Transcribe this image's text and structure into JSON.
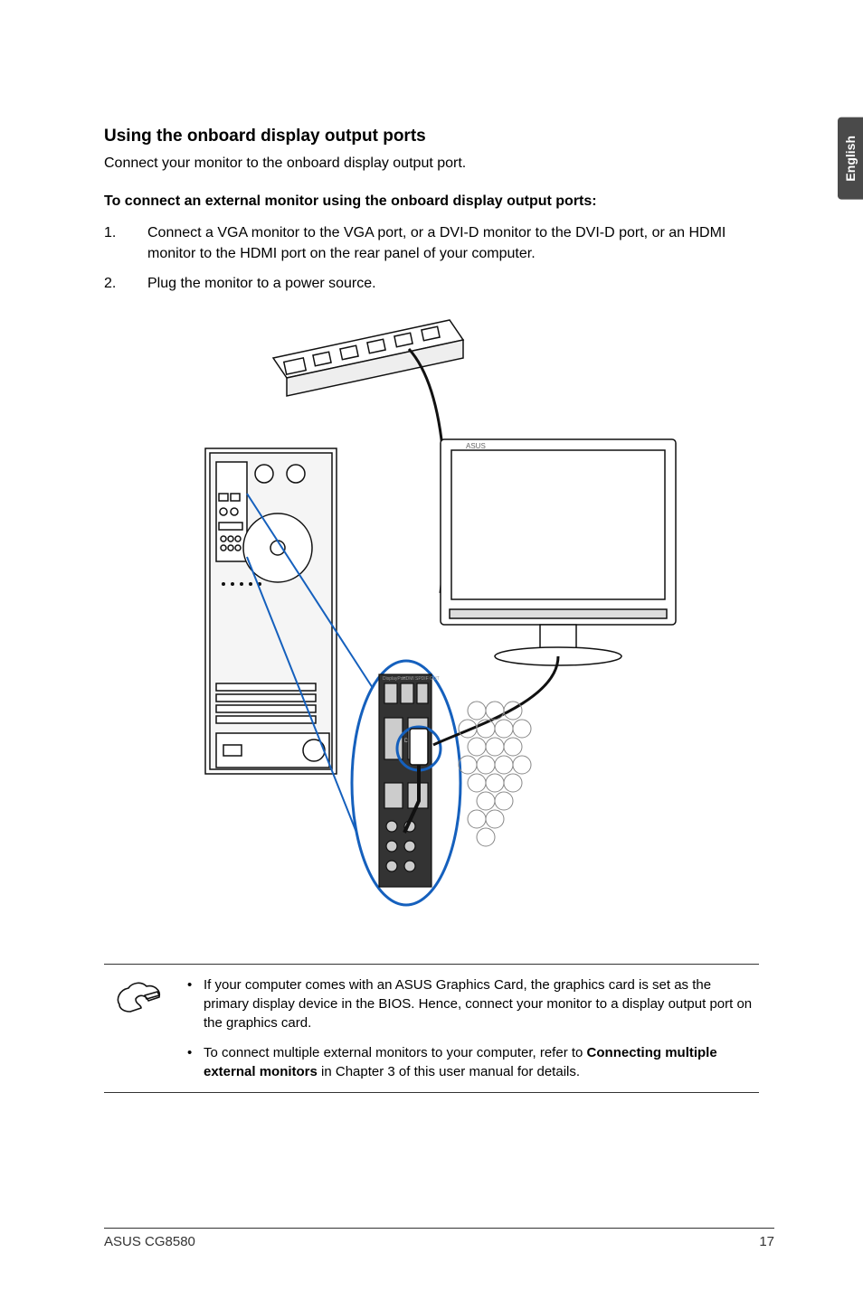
{
  "side_tab": "English",
  "heading": "Using the onboard display output ports",
  "intro": "Connect your monitor to the onboard display output port.",
  "subhead": "To connect an external monitor using the onboard display output ports:",
  "steps": [
    {
      "num": "1.",
      "text": "Connect a VGA monitor to the VGA port, or a DVI-D monitor to the DVI-D port, or an HDMI monitor to the HDMI port on the rear panel of your computer."
    },
    {
      "num": "2.",
      "text": "Plug the monitor to a power source."
    }
  ],
  "notes": [
    {
      "pre": "If your computer comes with an ASUS Graphics Card, the graphics card is set as the primary display device in the BIOS. Hence, connect your monitor to a display output port on the graphics card."
    },
    {
      "pre": "To connect multiple external monitors to your computer, refer to ",
      "bold": "Connecting multiple external monitors",
      "post": " in Chapter 3 of this user manual for details."
    }
  ],
  "footer_left": "ASUS CG8580",
  "footer_right": "17",
  "icons": {
    "note_hand": "note-hand-icon"
  },
  "diagram_alt": "Diagram: desktop tower rear panel connecting to external monitor and power strip via VGA cable"
}
